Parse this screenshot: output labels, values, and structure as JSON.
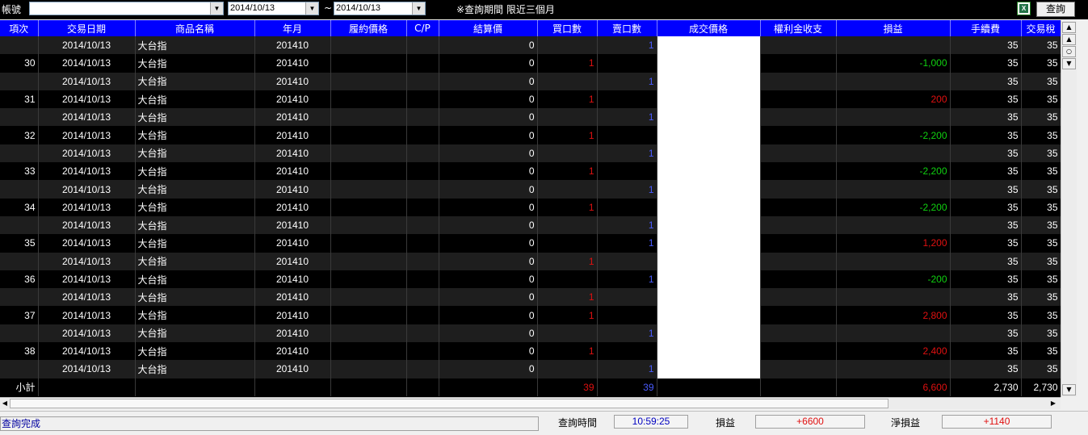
{
  "toolbar": {
    "account_label": "帳號",
    "account_value": "",
    "date_from": "2014/10/13",
    "date_sep": "~",
    "date_to": "2014/10/13",
    "notice": "※查詢期間 限近三個月",
    "query_label": "查詢"
  },
  "columns": [
    "項次",
    "交易日期",
    "商品名稱",
    "年月",
    "履約價格",
    "C/P",
    "結算價",
    "買口數",
    "賣口數",
    "成交價格",
    "權利金收支",
    "損益",
    "手續費",
    "交易稅"
  ],
  "rows": [
    {
      "idx": "",
      "date": "2014/10/13",
      "product": "大台指",
      "ym": "201410",
      "settle": "0",
      "buy": "",
      "sell": "1",
      "pl": "",
      "plc": "",
      "fee": "35",
      "tax": "35"
    },
    {
      "idx": "30",
      "date": "2014/10/13",
      "product": "大台指",
      "ym": "201410",
      "settle": "0",
      "buy": "1",
      "sell": "",
      "pl": "-1,000",
      "plc": "green",
      "fee": "35",
      "tax": "35"
    },
    {
      "idx": "",
      "date": "2014/10/13",
      "product": "大台指",
      "ym": "201410",
      "settle": "0",
      "buy": "",
      "sell": "1",
      "pl": "",
      "plc": "",
      "fee": "35",
      "tax": "35"
    },
    {
      "idx": "31",
      "date": "2014/10/13",
      "product": "大台指",
      "ym": "201410",
      "settle": "0",
      "buy": "1",
      "sell": "",
      "pl": "200",
      "plc": "red",
      "fee": "35",
      "tax": "35"
    },
    {
      "idx": "",
      "date": "2014/10/13",
      "product": "大台指",
      "ym": "201410",
      "settle": "0",
      "buy": "",
      "sell": "1",
      "pl": "",
      "plc": "",
      "fee": "35",
      "tax": "35"
    },
    {
      "idx": "32",
      "date": "2014/10/13",
      "product": "大台指",
      "ym": "201410",
      "settle": "0",
      "buy": "1",
      "sell": "",
      "pl": "-2,200",
      "plc": "green",
      "fee": "35",
      "tax": "35"
    },
    {
      "idx": "",
      "date": "2014/10/13",
      "product": "大台指",
      "ym": "201410",
      "settle": "0",
      "buy": "",
      "sell": "1",
      "pl": "",
      "plc": "",
      "fee": "35",
      "tax": "35"
    },
    {
      "idx": "33",
      "date": "2014/10/13",
      "product": "大台指",
      "ym": "201410",
      "settle": "0",
      "buy": "1",
      "sell": "",
      "pl": "-2,200",
      "plc": "green",
      "fee": "35",
      "tax": "35"
    },
    {
      "idx": "",
      "date": "2014/10/13",
      "product": "大台指",
      "ym": "201410",
      "settle": "0",
      "buy": "",
      "sell": "1",
      "pl": "",
      "plc": "",
      "fee": "35",
      "tax": "35"
    },
    {
      "idx": "34",
      "date": "2014/10/13",
      "product": "大台指",
      "ym": "201410",
      "settle": "0",
      "buy": "1",
      "sell": "",
      "pl": "-2,200",
      "plc": "green",
      "fee": "35",
      "tax": "35"
    },
    {
      "idx": "",
      "date": "2014/10/13",
      "product": "大台指",
      "ym": "201410",
      "settle": "0",
      "buy": "",
      "sell": "1",
      "pl": "",
      "plc": "",
      "fee": "35",
      "tax": "35"
    },
    {
      "idx": "35",
      "date": "2014/10/13",
      "product": "大台指",
      "ym": "201410",
      "settle": "0",
      "buy": "",
      "sell": "1",
      "pl": "1,200",
      "plc": "red",
      "fee": "35",
      "tax": "35"
    },
    {
      "idx": "",
      "date": "2014/10/13",
      "product": "大台指",
      "ym": "201410",
      "settle": "0",
      "buy": "1",
      "sell": "",
      "pl": "",
      "plc": "",
      "fee": "35",
      "tax": "35"
    },
    {
      "idx": "36",
      "date": "2014/10/13",
      "product": "大台指",
      "ym": "201410",
      "settle": "0",
      "buy": "",
      "sell": "1",
      "pl": "-200",
      "plc": "green",
      "fee": "35",
      "tax": "35"
    },
    {
      "idx": "",
      "date": "2014/10/13",
      "product": "大台指",
      "ym": "201410",
      "settle": "0",
      "buy": "1",
      "sell": "",
      "pl": "",
      "plc": "",
      "fee": "35",
      "tax": "35"
    },
    {
      "idx": "37",
      "date": "2014/10/13",
      "product": "大台指",
      "ym": "201410",
      "settle": "0",
      "buy": "1",
      "sell": "",
      "pl": "2,800",
      "plc": "red",
      "fee": "35",
      "tax": "35"
    },
    {
      "idx": "",
      "date": "2014/10/13",
      "product": "大台指",
      "ym": "201410",
      "settle": "0",
      "buy": "",
      "sell": "1",
      "pl": "",
      "plc": "",
      "fee": "35",
      "tax": "35"
    },
    {
      "idx": "38",
      "date": "2014/10/13",
      "product": "大台指",
      "ym": "201410",
      "settle": "0",
      "buy": "1",
      "sell": "",
      "pl": "2,400",
      "plc": "red",
      "fee": "35",
      "tax": "35"
    },
    {
      "idx": "",
      "date": "2014/10/13",
      "product": "大台指",
      "ym": "201410",
      "settle": "0",
      "buy": "",
      "sell": "1",
      "pl": "",
      "plc": "",
      "fee": "35",
      "tax": "35"
    }
  ],
  "subtotal": {
    "label": "小計",
    "buy": "39",
    "sell": "39",
    "pl": "6,600",
    "fee": "2,730",
    "tax": "2,730"
  },
  "status": {
    "message": "查詢完成",
    "time_label": "查詢時間",
    "time_value": "10:59:25",
    "pl_label": "損益",
    "pl_value": "+6600",
    "net_label": "淨損益",
    "net_value": "+1140"
  },
  "colors": {
    "header_bg": "#0000ff",
    "profit": "#e01010",
    "loss": "#10d010",
    "sell_qty": "#4a5cff",
    "buy_qty": "#e01010"
  }
}
